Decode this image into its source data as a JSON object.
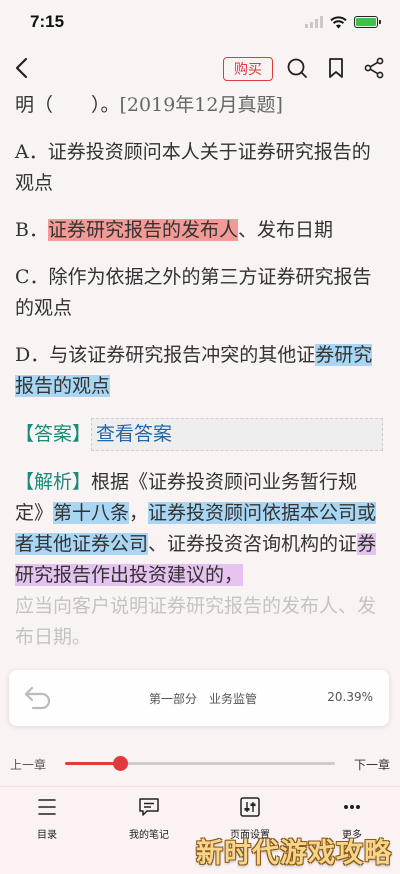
{
  "status_bar": {
    "time": "7:15"
  },
  "toolbar": {
    "buy_label": "购买"
  },
  "content": {
    "top_line_lead": "明（　　）。",
    "top_line_source": "[2019年12月真题]",
    "option_a": "A．证券投资顾问本人关于证券研究报告的观点",
    "option_b_prefix": "B．",
    "option_b_highlight": "证券研究报告的发布人",
    "option_b_suffix": "、发布日期",
    "option_c": "C．除作为依据之外的第三方证券研究报告的观点",
    "option_d_prefix": "D．与该证券研究报告冲突的其他证",
    "option_d_highlight": "券研究报告的观点",
    "answer_tag": "【答案】",
    "view_answer": "查看答案",
    "analysis_tag": "【解析】",
    "analysis_1": "根据《证券投资顾问业务暂行规定》",
    "analysis_hl_1": "第十八条",
    "analysis_2": "，",
    "analysis_hl_2": "证券投资顾问依据本公司或者其他证券公司",
    "analysis_3": "、证券投资咨询机构的证",
    "analysis_hl_3": "券研究报告作出投资建议的，",
    "faded_line_1": "应当向客户说明证券研究报告的发布",
    "faded_line_2": "人、发布日期。"
  },
  "progress": {
    "chapter_name": "第一部分　业务监管",
    "percent_text": "20.39%",
    "fraction": 0.2039
  },
  "slider": {
    "prev_label": "上一章",
    "next_label": "下一章",
    "accent": "#e0393e"
  },
  "tabs": [
    {
      "label": "目录",
      "icon": "menu-list-icon"
    },
    {
      "label": "我的笔记",
      "icon": "note-icon"
    },
    {
      "label": "页面设置",
      "icon": "settings-sliders-icon"
    },
    {
      "label": "更多",
      "icon": "more-dots-icon"
    }
  ],
  "watermark": "新时代游戏攻略"
}
